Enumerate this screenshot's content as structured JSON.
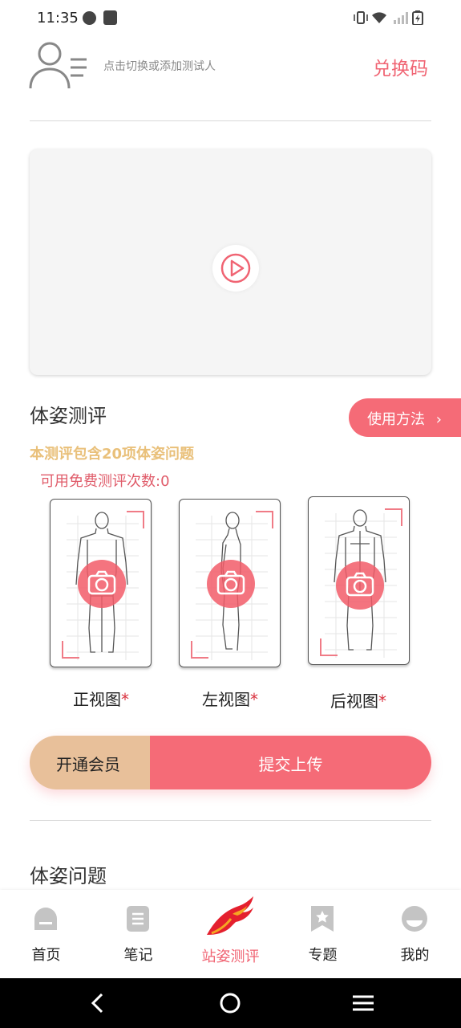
{
  "status_bar": {
    "time": "11:35"
  },
  "header": {
    "hint": "点击切换或添加测试人",
    "redeem_label": "兑换码",
    "avatar_icon": "user-list-icon"
  },
  "video": {
    "play_icon": "play-icon"
  },
  "assessment": {
    "title": "体姿测评",
    "how_to_label": "使用方法",
    "notice": "本测评包含20项体姿问题",
    "free_count": "可用免费测评次数:0",
    "views": [
      {
        "label": "正视图",
        "required_mark": "*"
      },
      {
        "label": "左视图",
        "required_mark": "*"
      },
      {
        "label": "后视图",
        "required_mark": "*"
      }
    ]
  },
  "actions": {
    "member_label": "开通会员",
    "submit_label": "提交上传"
  },
  "section2": {
    "title": "体姿问题"
  },
  "tabs": [
    {
      "label": "首页",
      "icon": "home-icon"
    },
    {
      "label": "笔记",
      "icon": "notes-icon"
    },
    {
      "label": "站姿测评",
      "icon": "posture-logo-icon",
      "active": true
    },
    {
      "label": "专题",
      "icon": "bookmark-star-icon"
    },
    {
      "label": "我的",
      "icon": "profile-icon"
    }
  ],
  "colors": {
    "accent": "#f56b77",
    "gold": "#e8c09a",
    "notice": "#e9c07a"
  }
}
